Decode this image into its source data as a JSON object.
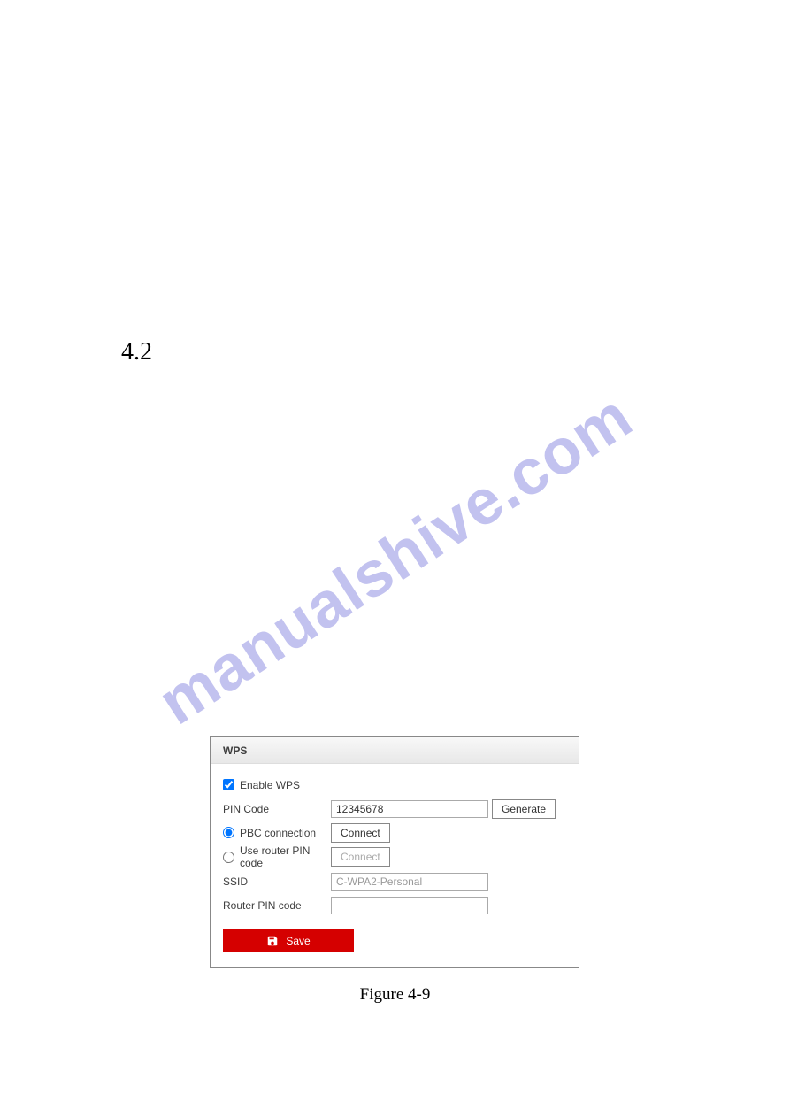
{
  "section_number": "4.2",
  "watermark": "manualshive.com",
  "wps": {
    "header": "WPS",
    "enable_label": "Enable WPS",
    "enable_checked": true,
    "pin_label": "PIN Code",
    "pin_value": "12345678",
    "generate_label": "Generate",
    "pbc_label": "PBC connection",
    "pbc_checked": true,
    "connect_pbc_label": "Connect",
    "routerpin_radio_label": "Use router PIN code",
    "routerpin_checked": false,
    "connect_pin_label": "Connect",
    "ssid_label": "SSID",
    "ssid_value": "C-WPA2-Personal",
    "routerpin_label": "Router PIN code",
    "routerpin_value": "",
    "save_label": "Save"
  },
  "figure_caption": "Figure 4-9"
}
